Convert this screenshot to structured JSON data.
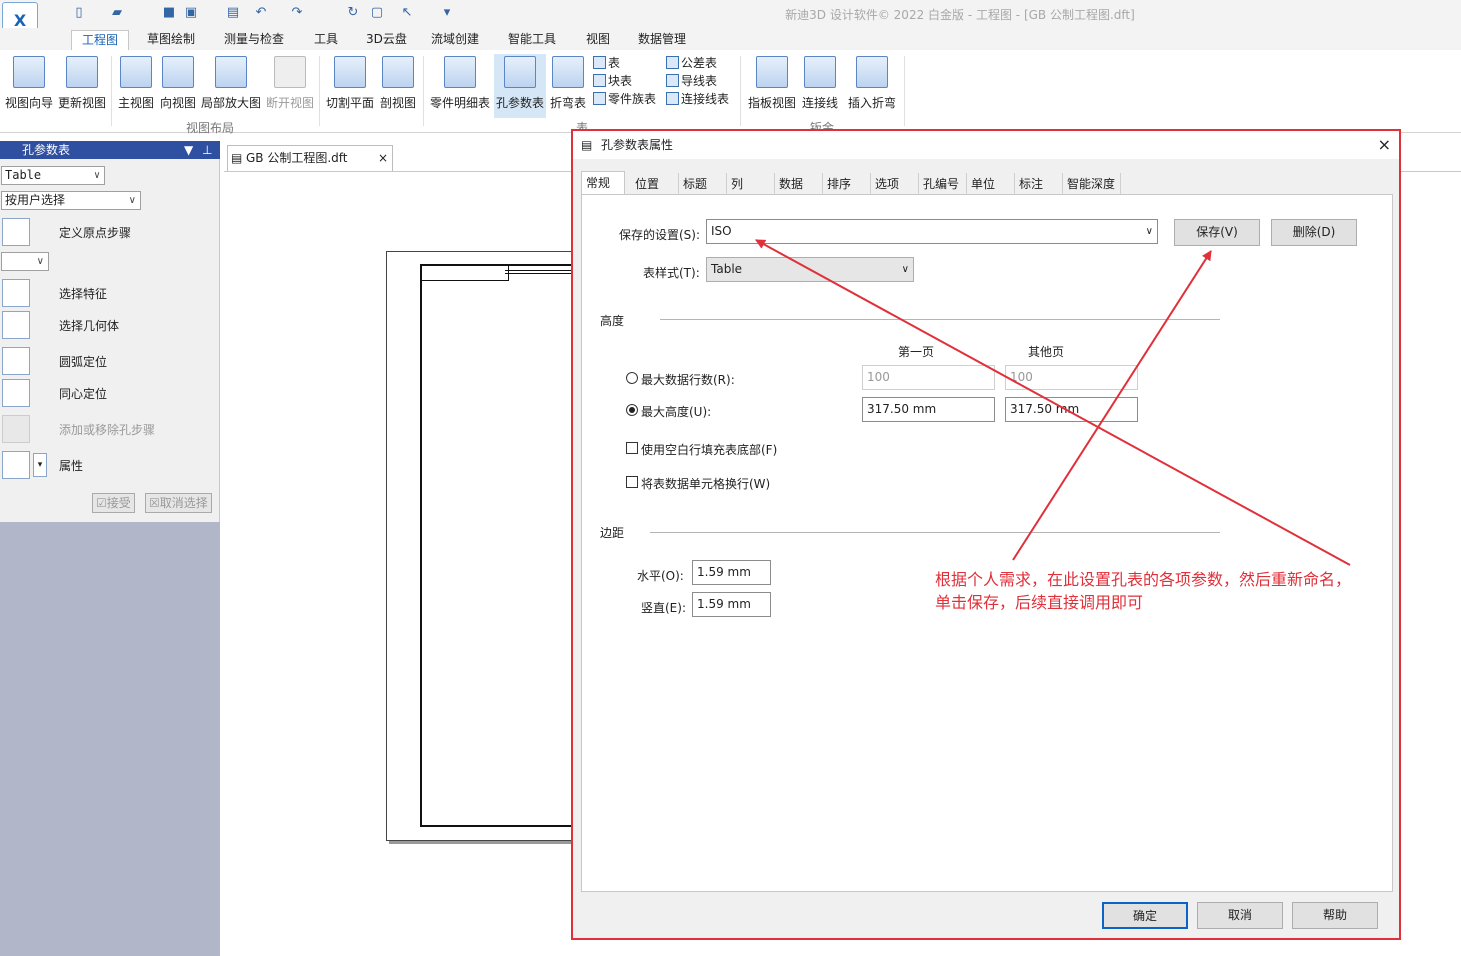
{
  "app": {
    "title": "新迪3D 设计软件© 2022 白金版 - 工程图 - [GB 公制工程图.dft]",
    "logo_text": "X"
  },
  "ribbon_tabs": [
    "工程图",
    "草图绘制",
    "测量与检查",
    "工具",
    "3D云盘",
    "流域创建",
    "智能工具",
    "视图",
    "数据管理"
  ],
  "ribbon": {
    "buttons": [
      {
        "label": "视图向导",
        "icon": "view-wizard-icon"
      },
      {
        "label": "更新视图",
        "icon": "update-view-icon"
      },
      {
        "label": "主视图",
        "icon": "main-view-icon"
      },
      {
        "label": "向视图",
        "icon": "aux-view-icon"
      },
      {
        "label": "局部放大图",
        "icon": "detail-view-icon"
      },
      {
        "label": "断开视图",
        "icon": "broken-view-icon"
      },
      {
        "label": "切割平面",
        "icon": "cutting-plane-icon"
      },
      {
        "label": "剖视图",
        "icon": "section-view-icon"
      },
      {
        "label": "零件明细表",
        "icon": "parts-list-icon"
      },
      {
        "label": "孔参数表",
        "icon": "hole-table-icon"
      },
      {
        "label": "折弯表",
        "icon": "bend-table-icon"
      },
      {
        "label": "指板视图",
        "icon": "flat-view-icon"
      },
      {
        "label": "连接线",
        "icon": "connector-icon"
      },
      {
        "label": "插入折弯",
        "icon": "insert-bend-icon"
      }
    ],
    "small_items": [
      "表",
      "块表",
      "零件族表",
      "公差表",
      "导线表",
      "连接线表"
    ],
    "groups": [
      "视图布局",
      "表",
      "钣金"
    ]
  },
  "panel": {
    "title": "孔参数表",
    "style_select": "Table",
    "select_mode": "按用户选择",
    "steps": [
      {
        "label": "定义原点步骤",
        "icon": "define-origin-icon",
        "enabled": true
      },
      {
        "label": "选择特征",
        "icon": "select-feature-icon",
        "enabled": true
      },
      {
        "label": "选择几何体",
        "icon": "select-geometry-icon",
        "enabled": true
      },
      {
        "label": "圆弧定位",
        "icon": "arc-locate-icon",
        "enabled": true
      },
      {
        "label": "同心定位",
        "icon": "concentric-locate-icon",
        "enabled": true
      },
      {
        "label": "添加或移除孔步骤",
        "icon": "add-remove-hole-icon",
        "enabled": false
      },
      {
        "label": "属性",
        "icon": "properties-icon",
        "enabled": true
      }
    ],
    "accept": "接受",
    "cancel_select": "取消选择"
  },
  "doc_tab": {
    "label": "GB 公制工程图.dft"
  },
  "dialog": {
    "title": "孔参数表属性",
    "tabs": [
      "常规",
      "位置",
      "标题",
      "列",
      "数据",
      "排序",
      "选项",
      "孔编号",
      "单位",
      "标注",
      "智能深度"
    ],
    "saved_setting_label": "保存的设置(S):",
    "saved_setting_value": "ISO",
    "save_button": "保存(V)",
    "delete_button": "删除(D)",
    "table_style_label": "表样式(T):",
    "table_style_value": "Table",
    "height_section": "高度",
    "first_page": "第一页",
    "other_pages": "其他页",
    "max_rows_label": "最大数据行数(R):",
    "max_rows_first": "100",
    "max_rows_other": "100",
    "max_height_label": "最大高度(U):",
    "max_height_first": "317.50 mm",
    "max_height_other": "317.50 mm",
    "fill_empty_rows": "使用空白行填充表底部(F)",
    "wrap_cells": "将表数据单元格换行(W)",
    "margin_section": "边距",
    "horizontal_label": "水平(O):",
    "horizontal_value": "1.59 mm",
    "vertical_label": "竖直(E):",
    "vertical_value": "1.59 mm",
    "ok": "确定",
    "cancel": "取消",
    "help": "帮助"
  },
  "annotation": {
    "line1": "根据个人需求，在此设置孔表的各项参数，然后重新命名，",
    "line2": "单击保存，后续直接调用即可",
    "color": "#e0303a"
  },
  "colors": {
    "accent": "#1a64b8",
    "panel_header": "#2f4fa0",
    "annotation": "#e0303a"
  }
}
